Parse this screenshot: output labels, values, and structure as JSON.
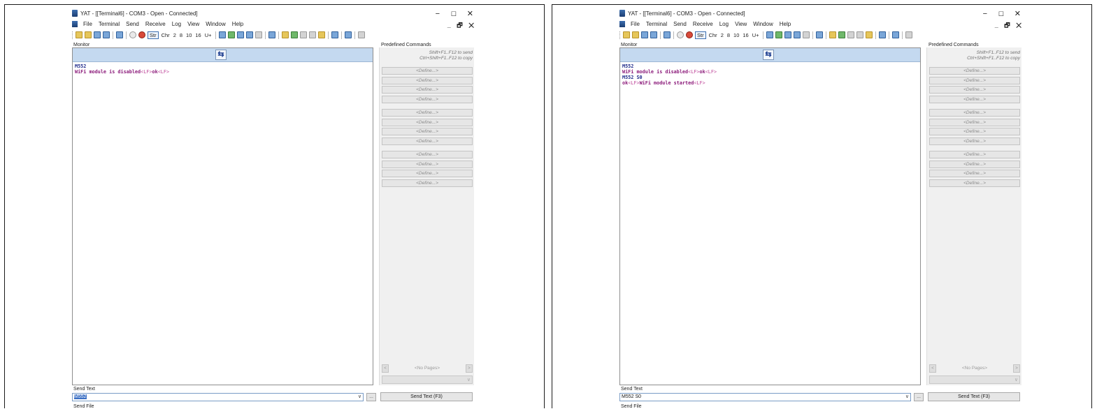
{
  "screens": [
    {
      "window_title": "YAT - [[Terminal6] - COM3 - Open - Connected]",
      "menu": [
        "File",
        "Terminal",
        "Send",
        "Receive",
        "Log",
        "View",
        "Window",
        "Help"
      ],
      "toolbar": {
        "str": "Str",
        "chr": "Chr",
        "r2": "2",
        "r8": "8",
        "r10": "10",
        "r16": "16",
        "unicode": "U+"
      },
      "monitor": {
        "label": "Monitor",
        "lines": [
          [
            {
              "text": "M552",
              "kind": "tx"
            }
          ],
          [
            {
              "text": "WiFi module is disabled",
              "kind": "rx"
            },
            {
              "text": "<LF>",
              "kind": "ctl"
            },
            {
              "text": "ok",
              "kind": "rx"
            },
            {
              "text": "<LF>",
              "kind": "ctl"
            }
          ]
        ]
      },
      "predefined": {
        "label": "Predefined Commands",
        "hint1": "Shift+F1..F12 to send",
        "hint2": "Ctrl+Shift+F1..F12 to copy",
        "define_label": "<Define...>",
        "no_pages": "<No Pages>"
      },
      "send": {
        "label": "Send Text",
        "value": "M552",
        "value_selected": true,
        "dots": "...",
        "button": "Send Text (F3)",
        "file_label": "Send File"
      }
    },
    {
      "window_title": "YAT - [[Terminal6] - COM3 - Open - Connected]",
      "menu": [
        "File",
        "Terminal",
        "Send",
        "Receive",
        "Log",
        "View",
        "Window",
        "Help"
      ],
      "toolbar": {
        "str": "Str",
        "chr": "Chr",
        "r2": "2",
        "r8": "8",
        "r10": "10",
        "r16": "16",
        "unicode": "U+"
      },
      "monitor": {
        "label": "Monitor",
        "lines": [
          [
            {
              "text": "M552",
              "kind": "tx"
            }
          ],
          [
            {
              "text": "WiFi module is disabled",
              "kind": "rx"
            },
            {
              "text": "<LF>",
              "kind": "ctl"
            },
            {
              "text": "ok",
              "kind": "rx"
            },
            {
              "text": "<LF>",
              "kind": "ctl"
            }
          ],
          [
            {
              "text": "M552 S0",
              "kind": "tx"
            }
          ],
          [
            {
              "text": "ok",
              "kind": "rx"
            },
            {
              "text": "<LF>",
              "kind": "ctl"
            },
            {
              "text": "WiFi module started",
              "kind": "rx"
            },
            {
              "text": "<LF>",
              "kind": "ctl"
            }
          ]
        ]
      },
      "predefined": {
        "label": "Predefined Commands",
        "hint1": "Shift+F1..F12 to send",
        "hint2": "Ctrl+Shift+F1..F12 to copy",
        "define_label": "<Define...>",
        "no_pages": "<No Pages>"
      },
      "send": {
        "label": "Send Text",
        "value": "M552 S0",
        "value_selected": false,
        "dots": "...",
        "button": "Send Text (F3)",
        "file_label": "Send File"
      }
    }
  ],
  "colors": {
    "tx": "#1f2a8a",
    "rx": "#8b1a7a",
    "ctl": "#c04a9c",
    "monitor_header": "#c4d9f0"
  },
  "icons": {
    "direction": "⇆",
    "minimize": "−",
    "maximize": "☐",
    "close": "✕",
    "mdi": "_ 🗗 ✕",
    "combo_caret": "∨",
    "page_prev": "<",
    "page_next": ">"
  }
}
